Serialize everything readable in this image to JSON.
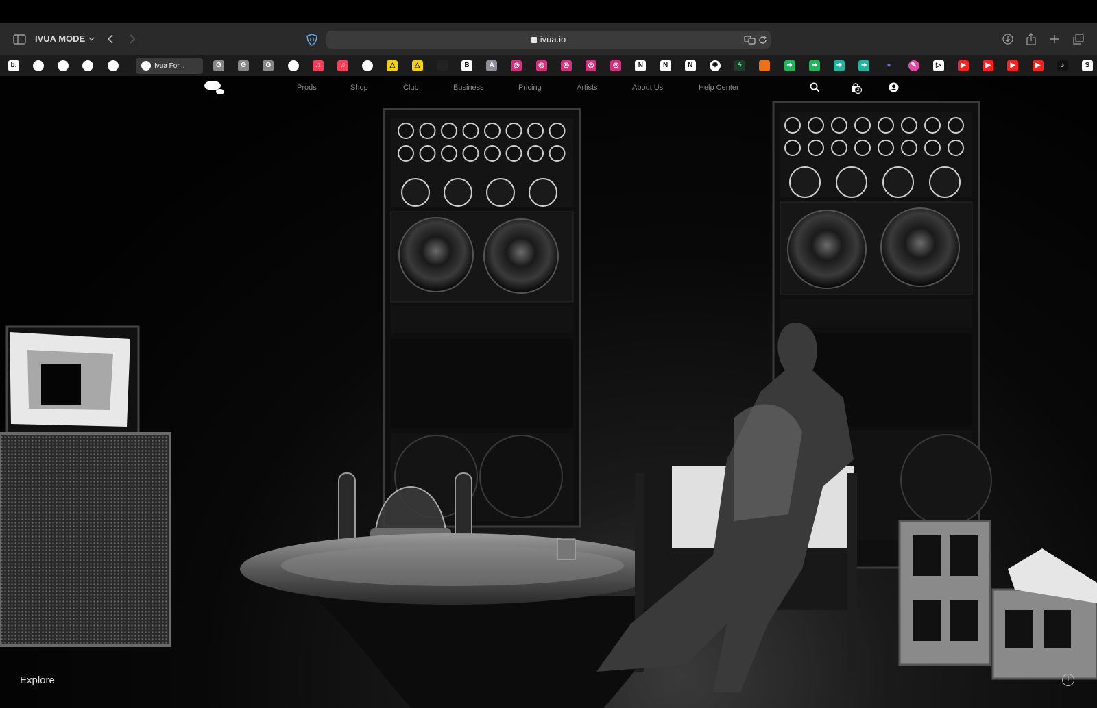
{
  "browser": {
    "profile_name": "IVUA MODE",
    "url": "ivua.io",
    "active_tab_title": "Ivua For..."
  },
  "bookmarks": [
    {
      "icon": "b-icon",
      "glyph": "b.",
      "bg": "#ffffff",
      "fg": "#111111"
    },
    {
      "icon": "circle-icon",
      "glyph": "",
      "bg": "#ffffff",
      "fg": "#111111"
    },
    {
      "icon": "circle-icon",
      "glyph": "",
      "bg": "#ffffff",
      "fg": "#111111"
    },
    {
      "icon": "circle-icon",
      "glyph": "",
      "bg": "#ffffff",
      "fg": "#111111"
    },
    {
      "icon": "circle-icon",
      "glyph": "",
      "bg": "#ffffff",
      "fg": "#111111"
    },
    {
      "icon": "g-icon",
      "glyph": "G",
      "bg": "#888888",
      "fg": "#ffffff"
    },
    {
      "icon": "g-icon",
      "glyph": "G",
      "bg": "#888888",
      "fg": "#ffffff"
    },
    {
      "icon": "g-icon",
      "glyph": "G",
      "bg": "#888888",
      "fg": "#ffffff"
    },
    {
      "icon": "apple-icon",
      "glyph": "",
      "bg": "#ffffff",
      "fg": "#111111"
    },
    {
      "icon": "music-icon",
      "glyph": "♫",
      "bg": "#fa3e5a",
      "fg": "#ffffff"
    },
    {
      "icon": "music-icon",
      "glyph": "♫",
      "bg": "#fa3e5a",
      "fg": "#ffffff"
    },
    {
      "icon": "apple-icon",
      "glyph": "",
      "bg": "#ffffff",
      "fg": "#111111"
    },
    {
      "icon": "triangle-icon",
      "glyph": "△",
      "bg": "#f2d20f",
      "fg": "#111111"
    },
    {
      "icon": "triangle-icon",
      "glyph": "△",
      "bg": "#f2d20f",
      "fg": "#111111"
    },
    {
      "icon": "square-icon",
      "glyph": "",
      "bg": "#222222",
      "fg": "#ffffff"
    },
    {
      "icon": "b-icon",
      "glyph": "B",
      "bg": "#ffffff",
      "fg": "#111111"
    },
    {
      "icon": "a-icon",
      "glyph": "A",
      "bg": "#8f8f9a",
      "fg": "#ffffff"
    },
    {
      "icon": "instagram-icon",
      "glyph": "◎",
      "bg": "#d6307b",
      "fg": "#ffffff"
    },
    {
      "icon": "instagram-icon",
      "glyph": "◎",
      "bg": "#d6307b",
      "fg": "#ffffff"
    },
    {
      "icon": "instagram-icon",
      "glyph": "◎",
      "bg": "#d6307b",
      "fg": "#ffffff"
    },
    {
      "icon": "instagram-icon",
      "glyph": "◎",
      "bg": "#d6307b",
      "fg": "#ffffff"
    },
    {
      "icon": "instagram-icon",
      "glyph": "◎",
      "bg": "#d6307b",
      "fg": "#ffffff"
    },
    {
      "icon": "notion-icon",
      "glyph": "N",
      "bg": "#ffffff",
      "fg": "#111111"
    },
    {
      "icon": "notion-icon",
      "glyph": "N",
      "bg": "#ffffff",
      "fg": "#111111"
    },
    {
      "icon": "notion-icon",
      "glyph": "N",
      "bg": "#ffffff",
      "fg": "#111111"
    },
    {
      "icon": "openai-icon",
      "glyph": "✺",
      "bg": "#ffffff",
      "fg": "#111111"
    },
    {
      "icon": "pulse-icon",
      "glyph": "ϟ",
      "bg": "#1f3b2a",
      "fg": "#4ee07a"
    },
    {
      "icon": "orange-icon",
      "glyph": "",
      "bg": "#e8731a",
      "fg": "#ffffff"
    },
    {
      "icon": "arrow-icon",
      "glyph": "➜",
      "bg": "#22b45a",
      "fg": "#ffffff"
    },
    {
      "icon": "arrow-icon",
      "glyph": "➜",
      "bg": "#22b45a",
      "fg": "#ffffff"
    },
    {
      "icon": "arrow-icon",
      "glyph": "➜",
      "bg": "#22b4a0",
      "fg": "#ffffff"
    },
    {
      "icon": "arrow-icon",
      "glyph": "➜",
      "bg": "#22b4a0",
      "fg": "#ffffff"
    },
    {
      "icon": "drop-icon",
      "glyph": "●",
      "bg": "#1c1c1c",
      "fg": "#5b6cf5"
    },
    {
      "icon": "circle-icon",
      "glyph": "✎",
      "bg": "#e24aa3",
      "fg": "#ffffff"
    },
    {
      "icon": "play-icon",
      "glyph": "▷",
      "bg": "#ffffff",
      "fg": "#111111"
    },
    {
      "icon": "youtube-icon",
      "glyph": "▶",
      "bg": "#ff1f1f",
      "fg": "#ffffff"
    },
    {
      "icon": "youtube-icon",
      "glyph": "▶",
      "bg": "#ff1f1f",
      "fg": "#ffffff"
    },
    {
      "icon": "youtube-icon",
      "glyph": "▶",
      "bg": "#ff1f1f",
      "fg": "#ffffff"
    },
    {
      "icon": "youtube-icon",
      "glyph": "▶",
      "bg": "#ff1f1f",
      "fg": "#ffffff"
    },
    {
      "icon": "tiktok-icon",
      "glyph": "♪",
      "bg": "#111111",
      "fg": "#ffffff"
    },
    {
      "icon": "s-icon",
      "glyph": "S",
      "bg": "#ffffff",
      "fg": "#111111"
    }
  ],
  "site": {
    "nav": [
      "Prods",
      "Shop",
      "Club",
      "Business",
      "Pricing",
      "Artists",
      "About Us",
      "Help Center"
    ],
    "cart_count": "2",
    "explore_label": "Explore",
    "info_glyph": "i"
  }
}
